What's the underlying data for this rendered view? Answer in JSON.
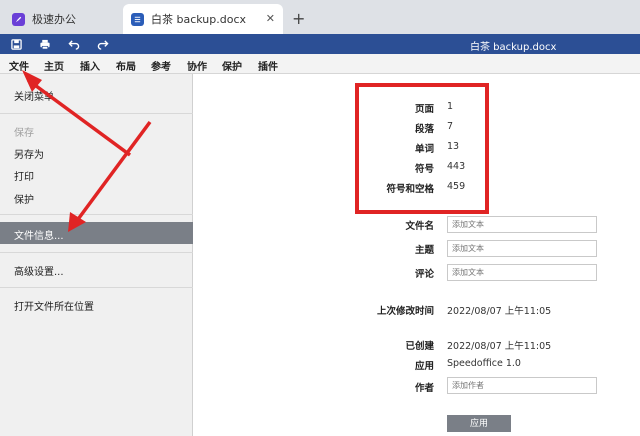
{
  "browser": {
    "tabs": [
      {
        "label": "极速办公",
        "active": false
      },
      {
        "label": "白茶 backup.docx",
        "active": true
      }
    ],
    "close_glyph": "✕",
    "new_tab_glyph": "+"
  },
  "toolbar": {
    "document_title": "白茶 backup.docx",
    "icons": [
      "save-icon",
      "print-icon",
      "undo-icon",
      "redo-icon"
    ],
    "color": "#2c4f95"
  },
  "menu": {
    "items": [
      "文件",
      "主页",
      "插入",
      "布局",
      "参考",
      "协作",
      "保护",
      "插件"
    ],
    "selected": "文件"
  },
  "file_panel": {
    "close_menu": "关闭菜单",
    "save": "保存",
    "save_as": "另存为",
    "print": "打印",
    "protect": "保护",
    "file_info": "文件信息...",
    "advanced": "高级设置...",
    "open_location": "打开文件所在位置"
  },
  "stats": [
    {
      "label": "页面",
      "value": "1"
    },
    {
      "label": "段落",
      "value": "7"
    },
    {
      "label": "单词",
      "value": "13"
    },
    {
      "label": "符号",
      "value": "443"
    },
    {
      "label": "符号和空格",
      "value": "459"
    }
  ],
  "info": {
    "filename_label": "文件名",
    "subject_label": "主题",
    "comment_label": "评论",
    "placeholder_text": "添加文本",
    "last_modified_label": "上次修改时间",
    "last_modified_value": "2022/08/07 上午11:05",
    "created_label": "已创建",
    "created_value": "2022/08/07 上午11:05",
    "app_label": "应用",
    "app_value": "Speedoffice 1.0",
    "author_label": "作者",
    "author_placeholder": "添加作者",
    "apply_button": "应用"
  },
  "annotation_color": "#e02424"
}
